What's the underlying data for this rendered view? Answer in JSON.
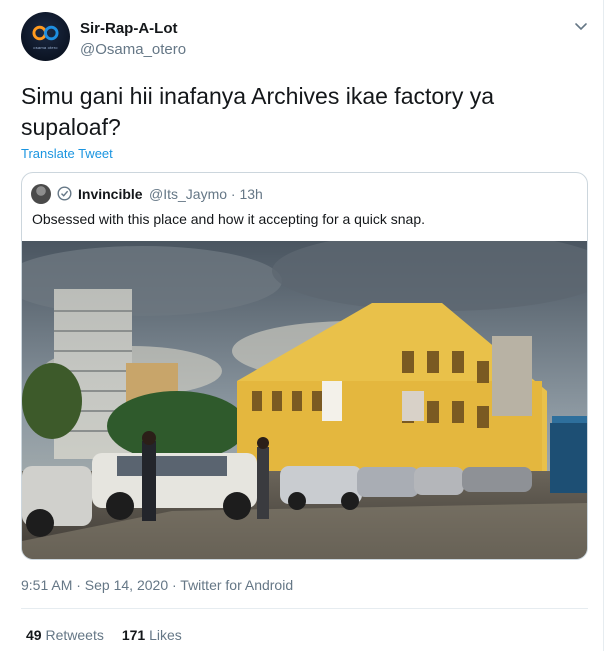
{
  "author": {
    "name": "Sir-Rap-A-Lot",
    "handle": "@Osama_otero",
    "avatar_brand": "osama otero"
  },
  "tweet": {
    "text": "Simu gani hii inafanya Archives ikae factory ya supaloaf?",
    "translate_label": "Translate Tweet",
    "timestamp": "9:51 AM · Sep 14, 2020 · Twitter for Android"
  },
  "quoted": {
    "name": "Invincible",
    "handle_time": "@Its_Jaymo · 13h",
    "text": "Obsessed with this place and how it accepting for a quick snap."
  },
  "stats": {
    "retweets_count": "49",
    "retweets_label": "Retweets",
    "likes_count": "171",
    "likes_label": "Likes"
  },
  "colors": {
    "link": "#1b95e0",
    "secondary": "#657786",
    "primary_text": "#14171a",
    "border": "#ccd6dd"
  },
  "icons": [
    "chevron-down-icon",
    "verified-badge-icon",
    "logo-icon"
  ]
}
